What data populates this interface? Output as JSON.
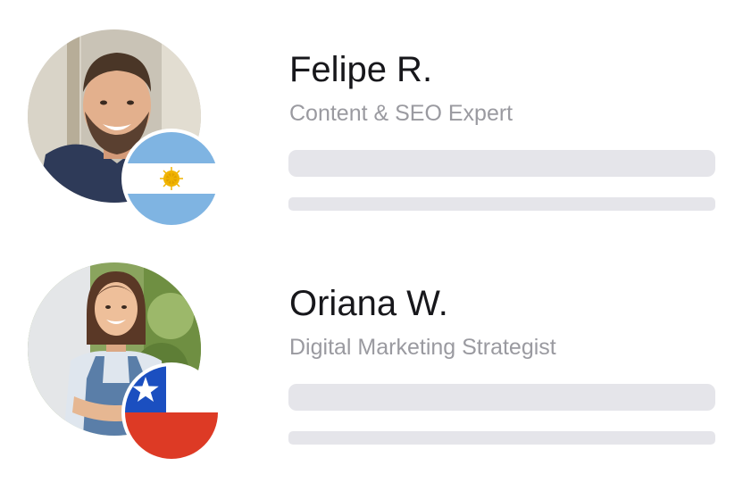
{
  "profiles": [
    {
      "name": "Felipe R.",
      "role": "Content & SEO Expert",
      "country_flag": "argentina-flag",
      "flag_colors": {
        "stripe": "#7fb4e2",
        "center": "#ffffff",
        "sun": "#f0b400"
      }
    },
    {
      "name": "Oriana W.",
      "role": "Digital Marketing Strategist",
      "country_flag": "chile-flag",
      "flag_colors": {
        "blue": "#1b4fc0",
        "white": "#ffffff",
        "red": "#dd3a25"
      }
    }
  ],
  "colors": {
    "name_text": "#17171b",
    "role_text": "#9a9aa0",
    "placeholder_bar": "#e5e5ea"
  }
}
